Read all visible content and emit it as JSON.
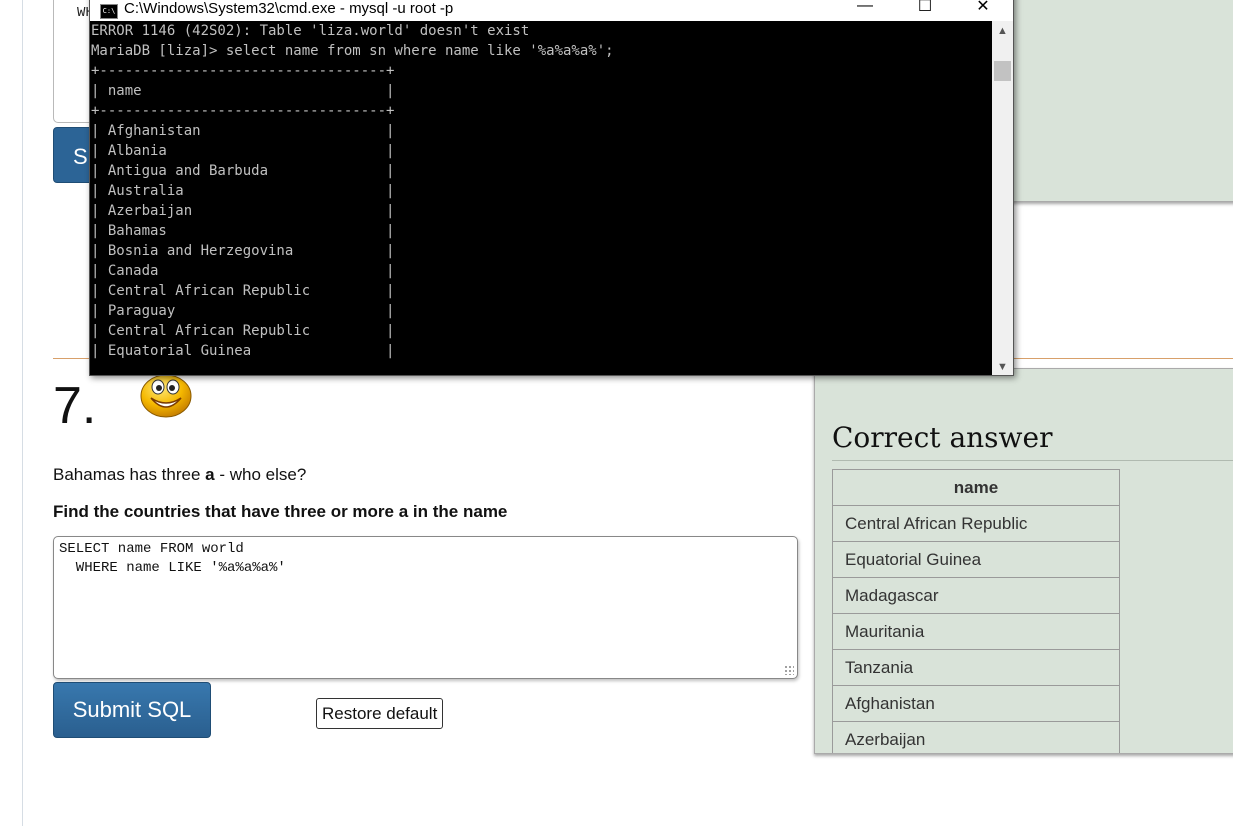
{
  "previous_question": {
    "textarea_fragment": "WH",
    "submit_fragment": "S"
  },
  "question": {
    "number": "7.",
    "intro_prefix": "Bahamas has three ",
    "intro_letter": "a",
    "intro_suffix": " - who else?",
    "task_prefix": "Find the countries that have three or more ",
    "task_letter": "a",
    "task_suffix": " in the name",
    "sql_lines": [
      "SELECT name FROM world",
      "  WHERE name LIKE '%a%a%a%'"
    ],
    "submit_label": "Submit SQL",
    "restore_label": "Restore default",
    "emoji_icon": "grinning-face-icon"
  },
  "answer": {
    "title": "Correct answer",
    "column": "name",
    "rows": [
      "Central African Republic",
      "Equatorial Guinea",
      "Madagascar",
      "Mauritania",
      "Tanzania",
      "Afghanistan",
      "Azerbaijan"
    ]
  },
  "cmd": {
    "title": "C:\\Windows\\System32\\cmd.exe - mysql  -u root -p",
    "lines": [
      "ERROR 1146 (42S02): Table 'liza.world' doesn't exist",
      "MariaDB [liza]> select name from sn where name like '%a%a%a%';",
      "+----------------------------------+",
      "| name                             |",
      "+----------------------------------+",
      "| Afghanistan                      |",
      "| Albania                          |",
      "| Antigua and Barbuda              |",
      "| Australia                        |",
      "| Azerbaijan                       |",
      "| Bahamas                          |",
      "| Bosnia and Herzegovina           |",
      "| Canada                           |",
      "| Central African Republic         |",
      "| Paraguay                         |",
      "| Central African Republic         |",
      "| Equatorial Guinea                |"
    ]
  },
  "colors": {
    "button_blue": "#2c6496",
    "answer_panel_bg": "#d9e3d9",
    "console_bg": "#000000",
    "console_text": "#c0c0c0",
    "section_rule": "#d8a06a"
  }
}
